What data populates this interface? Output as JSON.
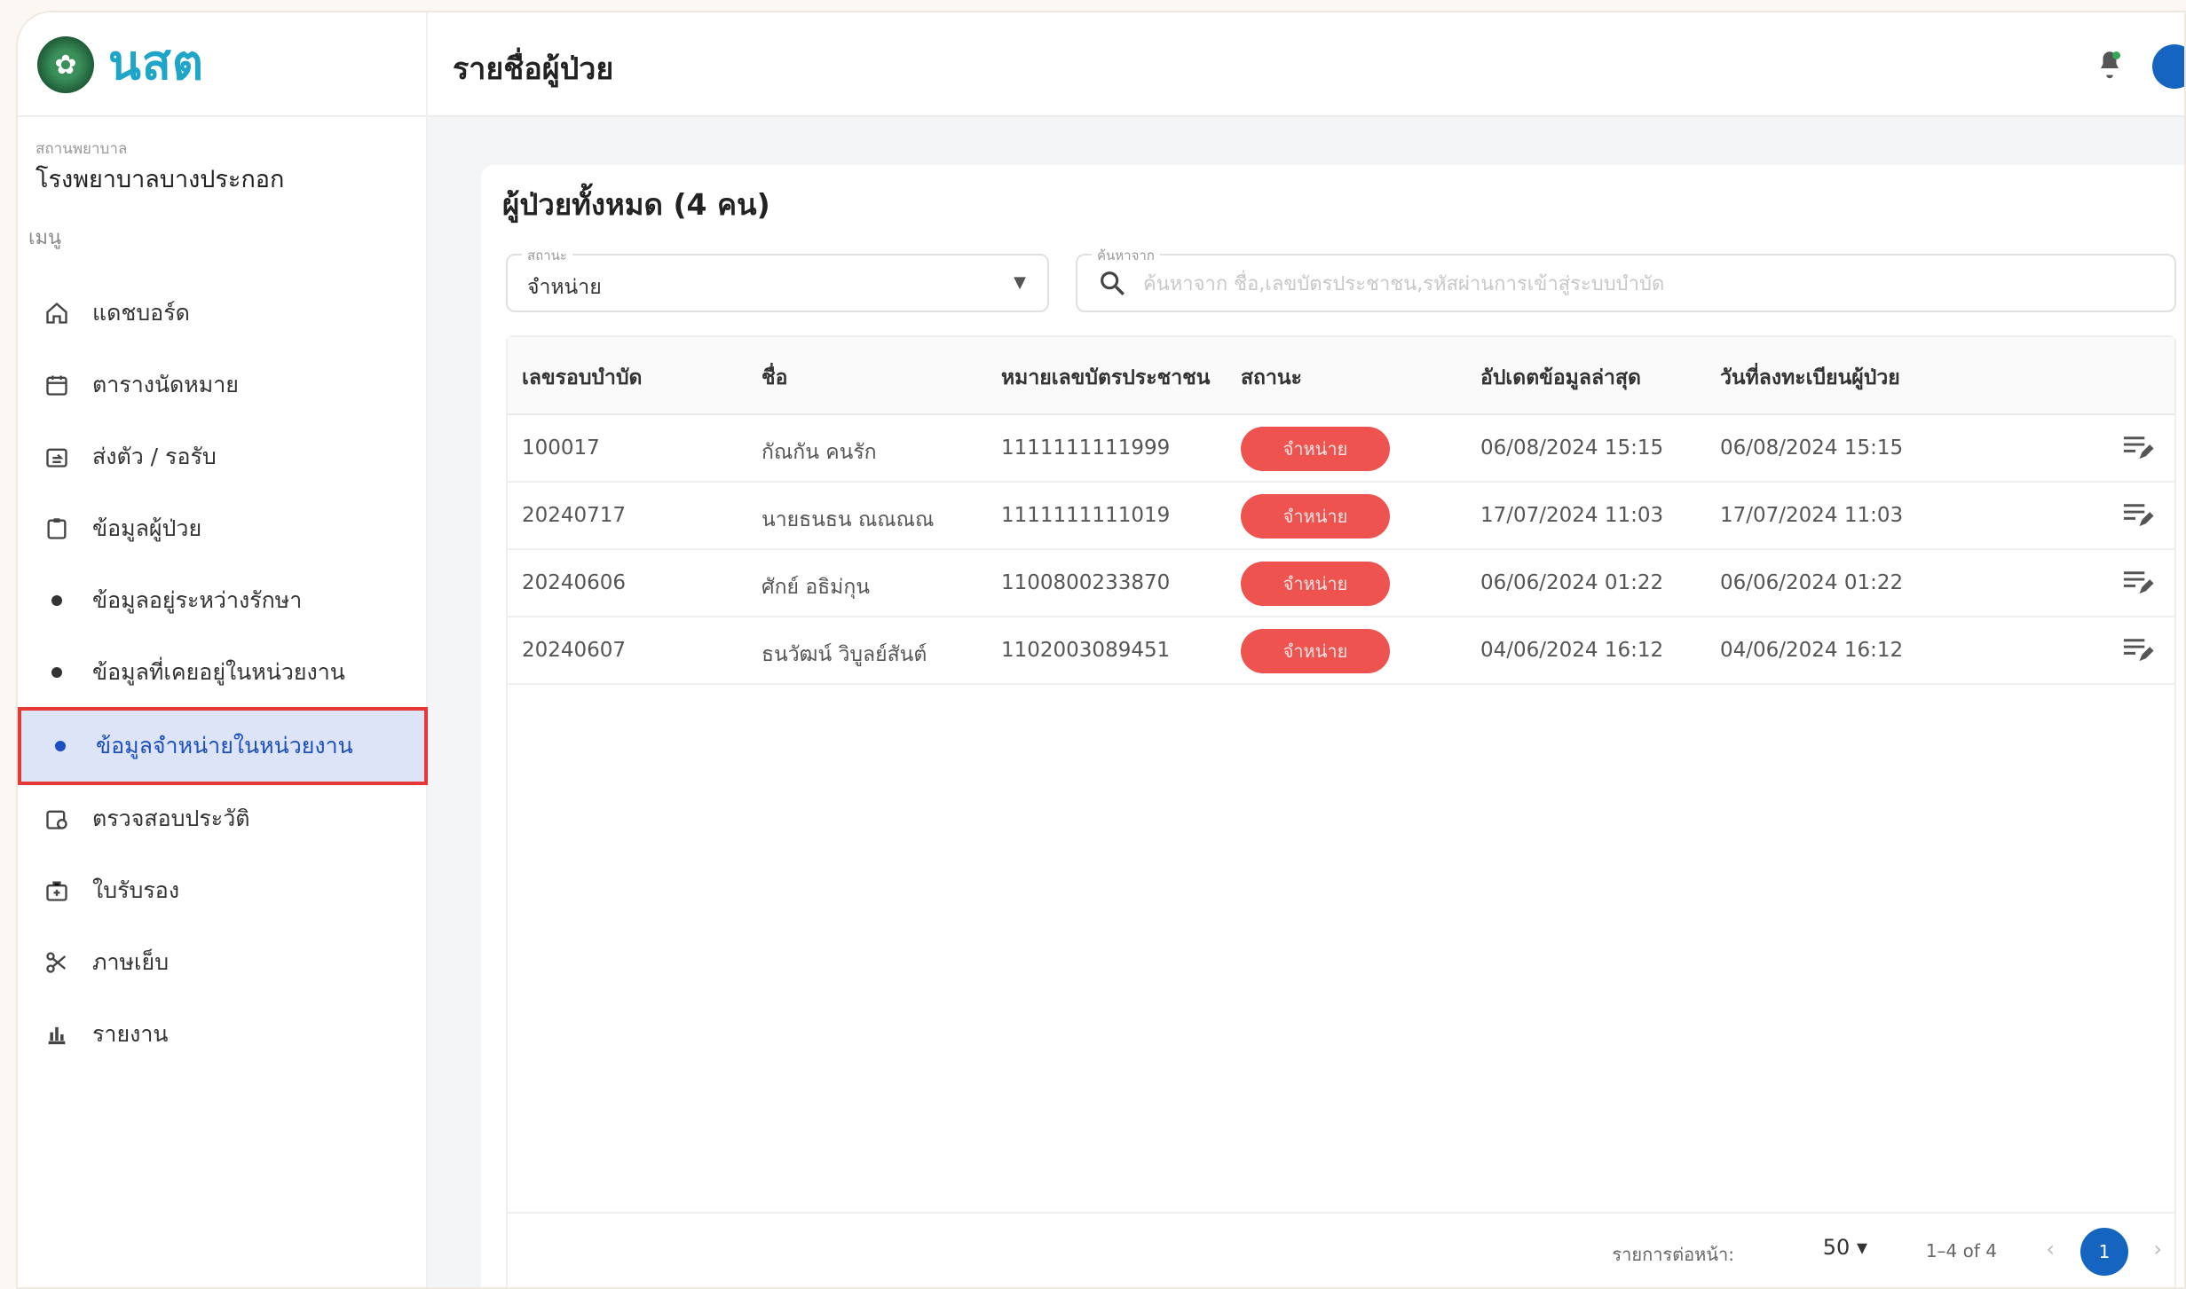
{
  "brand": {
    "name": "นสต"
  },
  "header": {
    "title": "รายชื่อผู้ป่วย"
  },
  "sidebar": {
    "hospital_label": "สถานพยาบาล",
    "hospital_name": "โรงพยาบาลบางประกอก",
    "menu_label": "เมนู",
    "items": [
      {
        "label": "แดชบอร์ด",
        "icon": "home-icon"
      },
      {
        "label": "ตารางนัดหมาย",
        "icon": "calendar-icon"
      },
      {
        "label": "ส่งตัว / รอรับ",
        "icon": "transfer-icon"
      },
      {
        "label": "ข้อมูลผู้ป่วย",
        "icon": "patient-icon"
      },
      {
        "label": "ข้อมูลอยู่ระหว่างรักษา",
        "icon": "dot-icon"
      },
      {
        "label": "ข้อมูลที่เคยอยู่ในหน่วยงาน",
        "icon": "dot-icon"
      },
      {
        "label": "ข้อมูลจำหน่ายในหน่วยงาน",
        "icon": "dot-icon",
        "active": true
      },
      {
        "label": "ตรวจสอบประวัติ",
        "icon": "history-icon"
      },
      {
        "label": "ใบรับรอง",
        "icon": "certificate-icon"
      },
      {
        "label": "ภาษเย็บ",
        "icon": "scissors-icon"
      },
      {
        "label": "รายงาน",
        "icon": "report-icon"
      }
    ]
  },
  "main": {
    "card_title": "ผู้ป่วยทั้งหมด (4 คน)",
    "status_filter": {
      "legend": "สถานะ",
      "value": "จำหน่าย"
    },
    "search": {
      "legend": "ค้นหาจาก",
      "placeholder": "ค้นหาจาก ชื่อ,เลขบัตรประชาชน,รหัสผ่านการเข้าสู่ระบบบำบัด"
    },
    "table": {
      "headers": [
        "เลขรอบบำบัด",
        "ชื่อ",
        "หมายเลขบัตรประชาชน",
        "สถานะ",
        "อัปเดตข้อมูลล่าสุด",
        "วันที่ลงทะเบียนผู้ป่วย"
      ],
      "rows": [
        {
          "id": "100017",
          "name": "กัณกัน คนรัก",
          "citizen_id": "1111111111999",
          "status": "จำหน่าย",
          "updated": "06/08/2024 15:15",
          "registered": "06/08/2024 15:15"
        },
        {
          "id": "20240717",
          "name": "นายธนธน ณณณณ",
          "citizen_id": "1111111111019",
          "status": "จำหน่าย",
          "updated": "17/07/2024 11:03",
          "registered": "17/07/2024 11:03"
        },
        {
          "id": "20240606",
          "name": "ศักย์ อธิม่กุน",
          "citizen_id": "1100800233870",
          "status": "จำหน่าย",
          "updated": "06/06/2024 01:22",
          "registered": "06/06/2024 01:22"
        },
        {
          "id": "20240607",
          "name": "ธนวัฒน์ วิบูลย์สันต์",
          "citizen_id": "1102003089451",
          "status": "จำหน่าย",
          "updated": "04/06/2024 16:12",
          "registered": "04/06/2024 16:12"
        }
      ]
    },
    "pagination": {
      "rows_label": "รายการต่อหน้า:",
      "rows_per_page": "50",
      "range": "1–4 of 4",
      "current_page": "1"
    }
  },
  "colors": {
    "accent": "#1565c0",
    "active_bg": "#dde4f7",
    "badge": "#ef5350",
    "highlight_border": "#e53935"
  }
}
